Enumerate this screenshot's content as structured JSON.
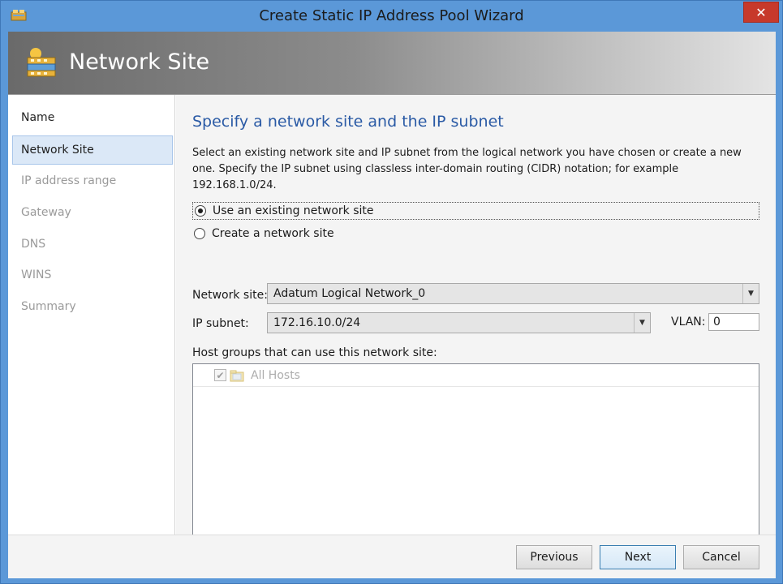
{
  "window": {
    "title": "Create Static IP Address Pool Wizard",
    "close_glyph": "✕"
  },
  "banner": {
    "title": "Network Site",
    "icon": "network-site-icon"
  },
  "nav": {
    "items": [
      {
        "label": "Name",
        "state": "done"
      },
      {
        "label": "Network Site",
        "state": "active"
      },
      {
        "label": "IP address range",
        "state": "pending"
      },
      {
        "label": "Gateway",
        "state": "pending"
      },
      {
        "label": "DNS",
        "state": "pending"
      },
      {
        "label": "WINS",
        "state": "pending"
      },
      {
        "label": "Summary",
        "state": "pending"
      }
    ]
  },
  "main": {
    "heading": "Specify a network site and the IP subnet",
    "description": "Select an existing network site and IP subnet from the logical network you have chosen or create a new one. Specify the IP subnet using classless inter-domain routing (CIDR) notation; for example 192.168.1.0/24.",
    "radio_existing": "Use an existing network site",
    "radio_create": "Create a network site",
    "network_site_label": "Network site:",
    "network_site_value": "Adatum Logical Network_0",
    "ip_subnet_label": "IP subnet:",
    "ip_subnet_value": "172.16.10.0/24",
    "vlan_label": "VLAN:",
    "vlan_value": "0",
    "host_groups_label": "Host groups that can use this network site:",
    "host_groups": [
      {
        "label": "All Hosts",
        "checked": true,
        "enabled": false
      }
    ]
  },
  "footer": {
    "previous": "Previous",
    "next": "Next",
    "cancel": "Cancel"
  },
  "colors": {
    "window_frame": "#5b98d8",
    "close_button": "#c7392b",
    "heading": "#2a5aa5",
    "nav_active_bg": "#dbe8f7"
  }
}
